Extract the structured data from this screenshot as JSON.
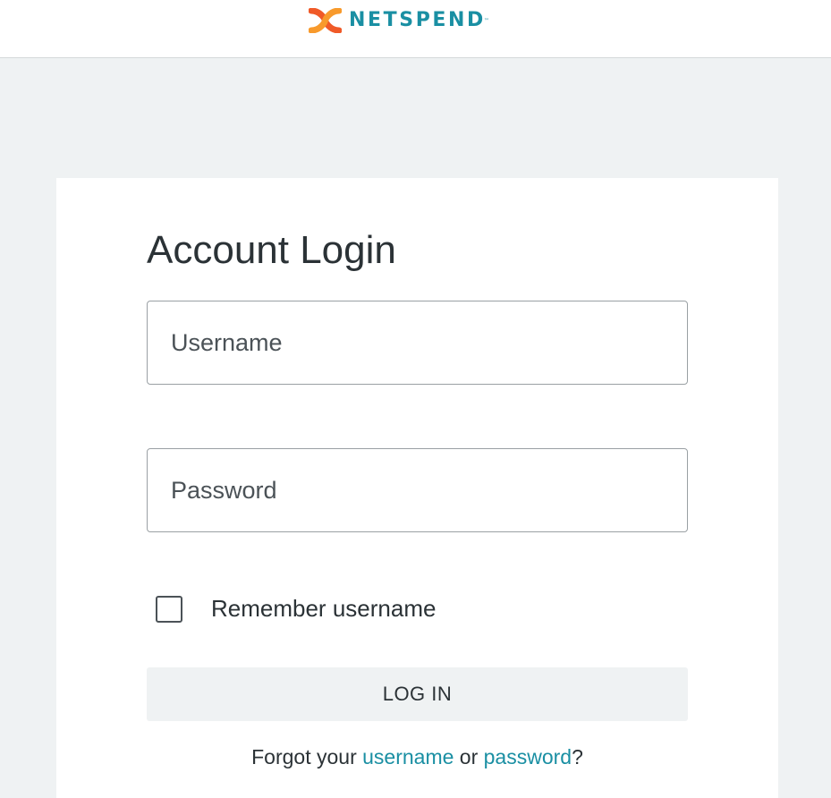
{
  "colors": {
    "brand_teal": "#1a8fa3",
    "brand_orange": "#f05a28",
    "brand_orange_light": "#f89a2c",
    "link": "#1a8fa3",
    "text": "#2b3236",
    "page_background": "#eff2f3",
    "button_background": "#eff2f3"
  },
  "header": {
    "logo_icon": "netspend-logo-icon",
    "logo_text": "NETSPEND",
    "logo_tm": "™"
  },
  "login": {
    "title": "Account Login",
    "username": {
      "value": "",
      "placeholder": "Username"
    },
    "password": {
      "value": "",
      "placeholder": "Password"
    },
    "remember": {
      "label": "Remember username",
      "checked": false
    },
    "submit_label": "LOG IN",
    "forgot": {
      "prefix": "Forgot your ",
      "username_link": "username",
      "middle": " or ",
      "password_link": "password",
      "suffix": "?"
    }
  }
}
